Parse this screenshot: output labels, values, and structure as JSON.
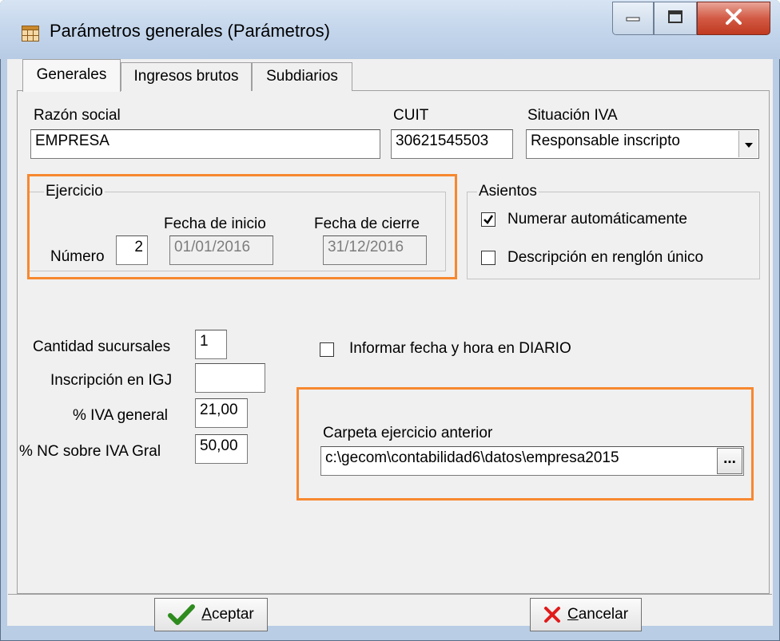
{
  "window": {
    "title": "Parámetros generales (Parámetros)"
  },
  "tabs": [
    {
      "label": "Generales",
      "active": true
    },
    {
      "label": "Ingresos brutos",
      "active": false
    },
    {
      "label": "Subdiarios",
      "active": false
    }
  ],
  "form": {
    "razon_social": {
      "label": "Razón social",
      "value": "EMPRESA"
    },
    "cuit": {
      "label": "CUIT",
      "value": "30621545503"
    },
    "situacion_iva": {
      "label": "Situación IVA",
      "value": "Responsable inscripto"
    }
  },
  "ejercicio": {
    "title": "Ejercicio",
    "numero_label": "Número",
    "numero_value": "2",
    "fecha_inicio_label": "Fecha de inicio",
    "fecha_inicio_value": "01/01/2016",
    "fecha_cierre_label": "Fecha de cierre",
    "fecha_cierre_value": "31/12/2016"
  },
  "asientos": {
    "title": "Asientos",
    "numerar": {
      "label": "Numerar automáticamente",
      "checked": true
    },
    "descripcion": {
      "label": "Descripción en renglón único",
      "checked": false
    }
  },
  "other": {
    "cantidad_sucursales": {
      "label": "Cantidad sucursales",
      "value": "1"
    },
    "inscripcion_igj": {
      "label": "Inscripción en IGJ",
      "value": ""
    },
    "iva_general": {
      "label": "% IVA general",
      "value": "21,00"
    },
    "nc_sobre_iva": {
      "label": "% NC sobre IVA Gral",
      "value": "50,00"
    },
    "informar_fecha": {
      "label": "Informar fecha y hora en DIARIO",
      "checked": false
    }
  },
  "carpeta": {
    "label": "Carpeta ejercicio anterior",
    "value": "c:\\gecom\\contabilidad6\\datos\\empresa2015",
    "browse_label": "..."
  },
  "buttons": {
    "accept_rest": "ceptar",
    "accept_key": "A",
    "cancel_rest": "ancelar",
    "cancel_key": "C"
  },
  "colors": {
    "highlight": "#f7882f",
    "accept_icon": "#2e8b1e",
    "cancel_icon": "#e11b1b"
  }
}
